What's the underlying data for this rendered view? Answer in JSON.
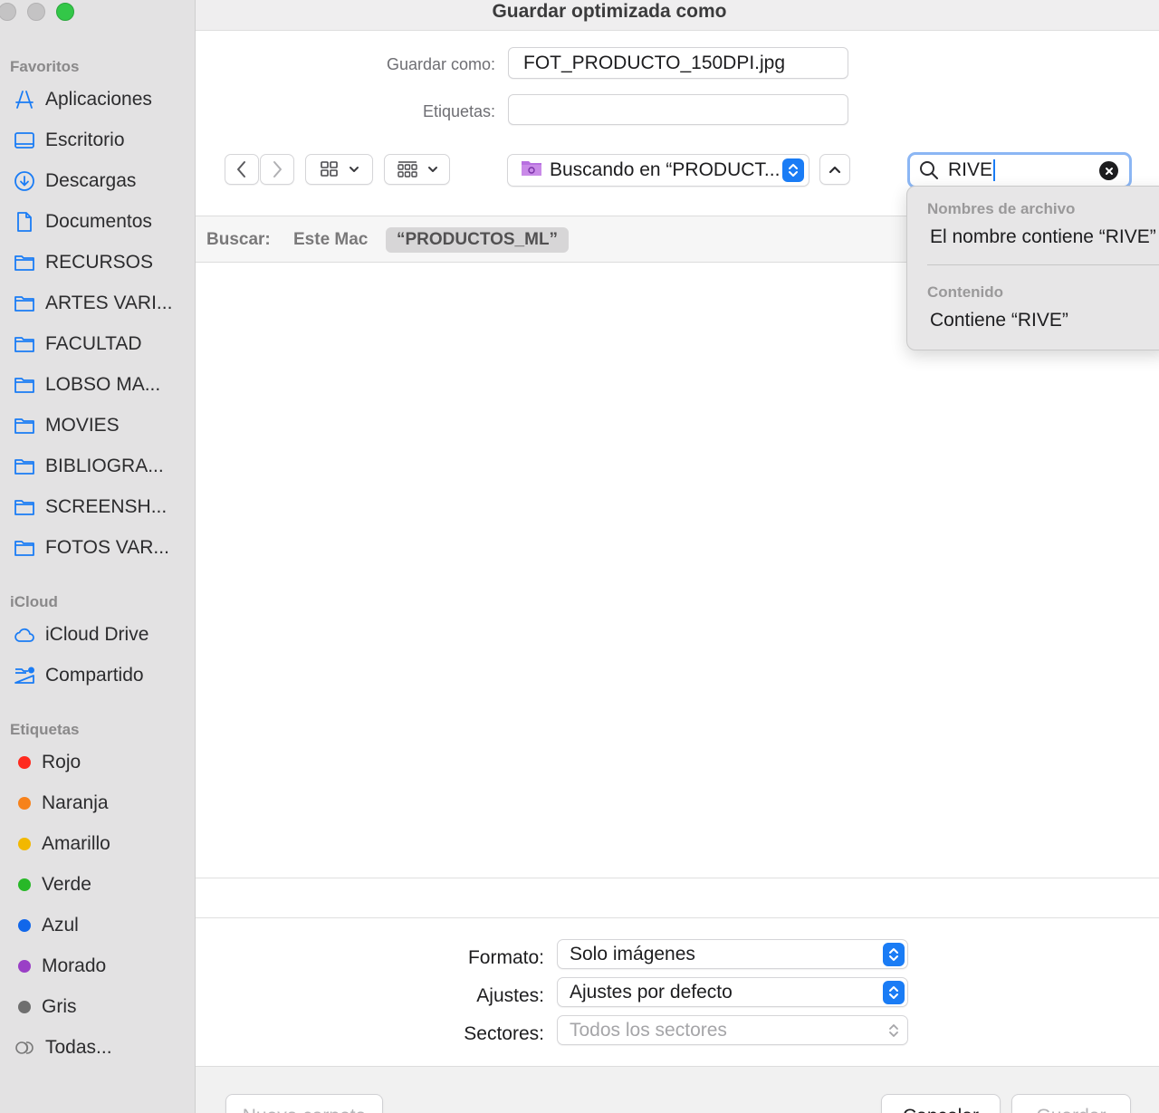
{
  "dialog": {
    "title": "Guardar optimizada como"
  },
  "sidebar": {
    "favorites_header": "Favoritos",
    "favorites": [
      {
        "label": "Aplicaciones",
        "icon": "apps-icon"
      },
      {
        "label": "Escritorio",
        "icon": "desktop-icon"
      },
      {
        "label": "Descargas",
        "icon": "download-icon"
      },
      {
        "label": "Documentos",
        "icon": "document-icon"
      },
      {
        "label": "RECURSOS",
        "icon": "folder-icon"
      },
      {
        "label": "ARTES VARI...",
        "icon": "folder-icon"
      },
      {
        "label": "FACULTAD",
        "icon": "folder-icon"
      },
      {
        "label": "LOBSO MA...",
        "icon": "folder-icon"
      },
      {
        "label": "MOVIES",
        "icon": "folder-icon"
      },
      {
        "label": "BIBLIOGRA...",
        "icon": "folder-icon"
      },
      {
        "label": "SCREENSH...",
        "icon": "folder-icon"
      },
      {
        "label": "FOTOS VAR...",
        "icon": "folder-icon"
      }
    ],
    "icloud_header": "iCloud",
    "icloud": [
      {
        "label": "iCloud Drive",
        "icon": "cloud-icon"
      },
      {
        "label": "Compartido",
        "icon": "shared-folder-icon"
      }
    ],
    "tags_header": "Etiquetas",
    "tags": [
      {
        "label": "Rojo",
        "color": "#ff2a1f"
      },
      {
        "label": "Naranja",
        "color": "#f7821b"
      },
      {
        "label": "Amarillo",
        "color": "#f2b800"
      },
      {
        "label": "Verde",
        "color": "#28b828"
      },
      {
        "label": "Azul",
        "color": "#1167ea"
      },
      {
        "label": "Morado",
        "color": "#9a3fc6"
      },
      {
        "label": "Gris",
        "color": "#6f6f6f"
      }
    ],
    "all_tags": "Todas..."
  },
  "form": {
    "save_as_label": "Guardar como:",
    "save_as_value": "FOT_PRODUCTO_150DPI.jpg",
    "tags_label": "Etiquetas:",
    "tags_value": ""
  },
  "toolbar": {
    "location": "Buscando en “PRODUCT...",
    "search_value": "RIVE"
  },
  "scope": {
    "label": "Buscar:",
    "this_mac": "Este Mac",
    "selected": "“PRODUCTOS_ML”"
  },
  "suggestions": {
    "filenames_header": "Nombres de archivo",
    "filename_item": "El nombre contiene “RIVE”",
    "content_header": "Contenido",
    "content_item": "Contiene “RIVE”"
  },
  "options": {
    "format_label": "Formato:",
    "format_value": "Solo imágenes",
    "settings_label": "Ajustes:",
    "settings_value": "Ajustes por defecto",
    "slices_label": "Sectores:",
    "slices_value": "Todos los sectores"
  },
  "buttons": {
    "new_folder": "Nueva carpeta",
    "cancel": "Cancelar",
    "save": "Guardar"
  },
  "colors": {
    "accent": "#1a7cf5",
    "sidebar_bg": "#e3e2e3"
  }
}
